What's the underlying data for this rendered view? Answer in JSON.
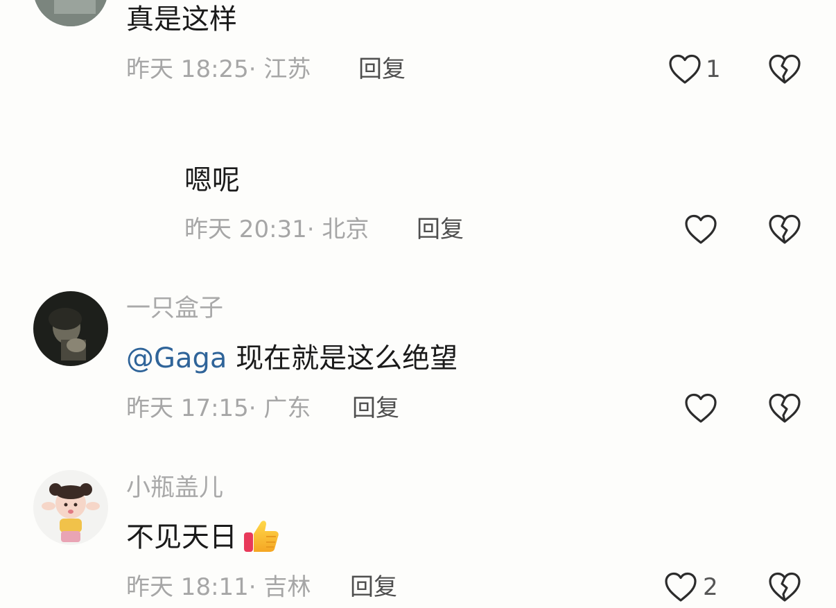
{
  "comments": [
    {
      "content": "真是这样",
      "time": "昨天 18:25",
      "location": "· 江苏",
      "reply_label": "回复",
      "like_count": "1"
    },
    {
      "content": "嗯呢",
      "time": "昨天 20:31",
      "location": "· 北京",
      "reply_label": "回复",
      "like_count": ""
    },
    {
      "username": "一只盒子",
      "mention": "@Gaga",
      "content": " 现在就是这么绝望",
      "time": "昨天 17:15",
      "location": "· 广东",
      "reply_label": "回复",
      "like_count": ""
    },
    {
      "username": "小瓶盖儿",
      "content": "不见天日",
      "emoji": "thumbs-up-emoji",
      "time": "昨天 18:11",
      "location": "· 吉林",
      "reply_label": "回复",
      "like_count": "2"
    }
  ],
  "icons": {
    "like": "heart-outline-icon",
    "dislike": "broken-heart-icon"
  },
  "colors": {
    "background": "#fdfdfb",
    "mention": "#2f6499",
    "meta": "#a6a6a6"
  }
}
